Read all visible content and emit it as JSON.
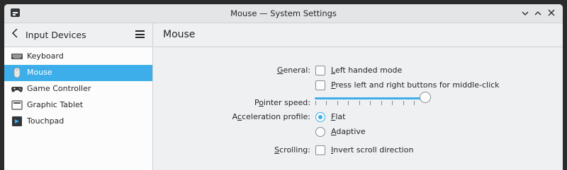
{
  "window": {
    "title": "Mouse — System Settings"
  },
  "sidebar": {
    "title": "Input Devices",
    "items": [
      {
        "label": "Keyboard",
        "icon": "keyboard-icon",
        "selected": false
      },
      {
        "label": "Mouse",
        "icon": "mouse-icon",
        "selected": true
      },
      {
        "label": "Game Controller",
        "icon": "gamepad-icon",
        "selected": false
      },
      {
        "label": "Graphic Tablet",
        "icon": "tablet-icon",
        "selected": false
      },
      {
        "label": "Touchpad",
        "icon": "touchpad-icon",
        "selected": false
      }
    ]
  },
  "main": {
    "title": "Mouse",
    "general": {
      "label_prefix": "G",
      "label_rest": "eneral:",
      "left_handed": {
        "u": "L",
        "rest": "eft handed mode",
        "checked": false
      },
      "middle_click": {
        "u": "P",
        "rest": "ress left and right buttons for middle-click",
        "checked": false
      }
    },
    "pointer_speed": {
      "label_pre": "P",
      "label_u": "o",
      "label_rest": "inter speed:",
      "value": 1.0
    },
    "acceleration": {
      "label_pre": "A",
      "label_u": "c",
      "label_rest": "celeration profile:",
      "flat": {
        "u": "F",
        "rest": "lat",
        "selected": true
      },
      "adaptive": {
        "u": "A",
        "rest": "daptive",
        "selected": false
      }
    },
    "scrolling": {
      "label_u": "S",
      "label_rest": "crolling:",
      "invert": {
        "u": "I",
        "rest": "nvert scroll direction",
        "checked": false
      }
    }
  },
  "colors": {
    "accent": "#3daee9",
    "background": "#eff0f1",
    "sidebar": "#fcfcfc"
  }
}
